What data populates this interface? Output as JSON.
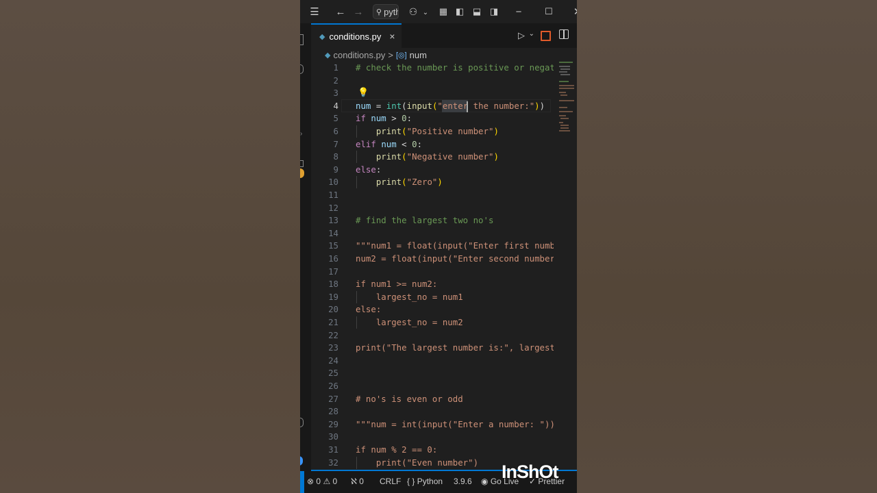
{
  "titlebar": {
    "search_text": "pytho"
  },
  "tab": {
    "filename": "conditions.py",
    "close_glyph": "×"
  },
  "breadcrumb": {
    "file": "conditions.py",
    "separator": ">",
    "symbol": "num"
  },
  "editor": {
    "line_numbers": [
      "1",
      "2",
      "3",
      "4",
      "5",
      "6",
      "7",
      "8",
      "9",
      "10",
      "11",
      "12",
      "13",
      "14",
      "15",
      "16",
      "17",
      "18",
      "19",
      "20",
      "21",
      "22",
      "23",
      "24",
      "25",
      "26",
      "27",
      "28",
      "29",
      "30",
      "31",
      "32"
    ],
    "active_line": "4"
  },
  "status": {
    "errors": "0",
    "warnings": "0",
    "ports": "0",
    "eol": "CRLF",
    "language": "Python",
    "version": "3.9.6",
    "go_live": "Go Live",
    "prettier": "Prettier"
  },
  "watermark": "InShOt",
  "colors": {
    "accent": "#0078d4",
    "editor_bg": "#1f1f1f",
    "background": "#5a4c41"
  }
}
